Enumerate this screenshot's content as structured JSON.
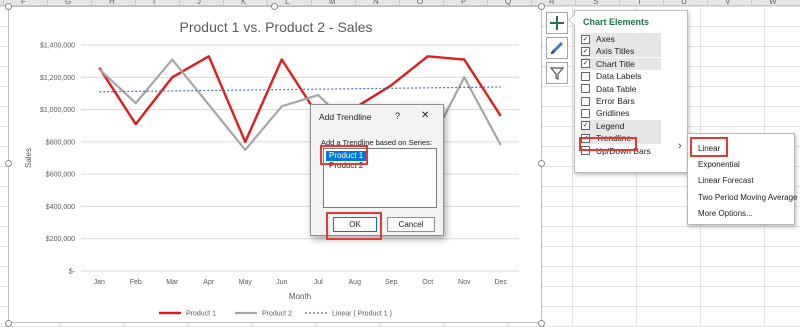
{
  "sheet": {
    "columns": [
      "F",
      "G",
      "H",
      "I",
      "J",
      "K",
      "L",
      "M",
      "N",
      "O",
      "P",
      "Q",
      "R",
      "S",
      "T",
      "U",
      "V",
      "W"
    ]
  },
  "chart": {
    "buttons": [
      "chart-elements-plus",
      "chart-styles-brush",
      "chart-filters-funnel"
    ]
  },
  "chart_data": {
    "type": "line",
    "title": "Product 1 vs. Product 2 - Sales",
    "xlabel": "Month",
    "ylabel": "Sales",
    "categories": [
      "Jan",
      "Feb",
      "Mar",
      "Apr",
      "May",
      "Jun",
      "Jul",
      "Aug",
      "Sep",
      "Oct",
      "Nov",
      "Dec"
    ],
    "ylim": [
      0,
      1400000
    ],
    "yticks": [
      {
        "value": 0,
        "label": "$-"
      },
      {
        "value": 200000,
        "label": "$200,000"
      },
      {
        "value": 400000,
        "label": "$400,000"
      },
      {
        "value": 600000,
        "label": "$600,000"
      },
      {
        "value": 800000,
        "label": "$800,000"
      },
      {
        "value": 1000000,
        "label": "$1,000,000"
      },
      {
        "value": 1200000,
        "label": "$1,200,000"
      },
      {
        "value": 1400000,
        "label": "$1,400,000"
      }
    ],
    "series": [
      {
        "name": "Product 1",
        "color": "#e41a1c",
        "values": [
          1260000,
          910000,
          1200000,
          1330000,
          800000,
          1310000,
          960000,
          1010000,
          1150000,
          1330000,
          1310000,
          960000
        ]
      },
      {
        "name": "Product 2",
        "color": "#a6a6a6",
        "values": [
          1250000,
          1040000,
          1310000,
          1030000,
          750000,
          1020000,
          1090000,
          870000,
          770000,
          760000,
          1200000,
          780000
        ]
      }
    ],
    "trendline": {
      "name": "Linear ( Product 1 )",
      "color": "#4472c4",
      "values": [
        1110000,
        1140000
      ]
    },
    "legend_position": "bottom",
    "grid": "horizontal"
  },
  "chart_elements": {
    "title": "Chart Elements",
    "items": [
      {
        "label": "Axes",
        "checked": true
      },
      {
        "label": "Axis Titles",
        "checked": true
      },
      {
        "label": "Chart Title",
        "checked": true
      },
      {
        "label": "Data Labels",
        "checked": false
      },
      {
        "label": "Data Table",
        "checked": false
      },
      {
        "label": "Error Bars",
        "checked": false
      },
      {
        "label": "Gridlines",
        "checked": false
      },
      {
        "label": "Legend",
        "checked": true
      },
      {
        "label": "Trendline",
        "checked": true
      },
      {
        "label": "Up/Down Bars",
        "checked": false
      }
    ],
    "check_glyph": "☑"
  },
  "trendline_menu": {
    "items": [
      "Linear",
      "Exponential",
      "Linear Forecast",
      "Two Period Moving Average",
      "More Options..."
    ]
  },
  "dialog": {
    "title": "Add Trendline",
    "help": "?",
    "close": "✕",
    "prompt": "Add a Trendline based on Series:",
    "options": [
      "Product 1",
      "Product 2"
    ],
    "selected": "Product 1",
    "ok": "OK",
    "cancel": "Cancel"
  }
}
